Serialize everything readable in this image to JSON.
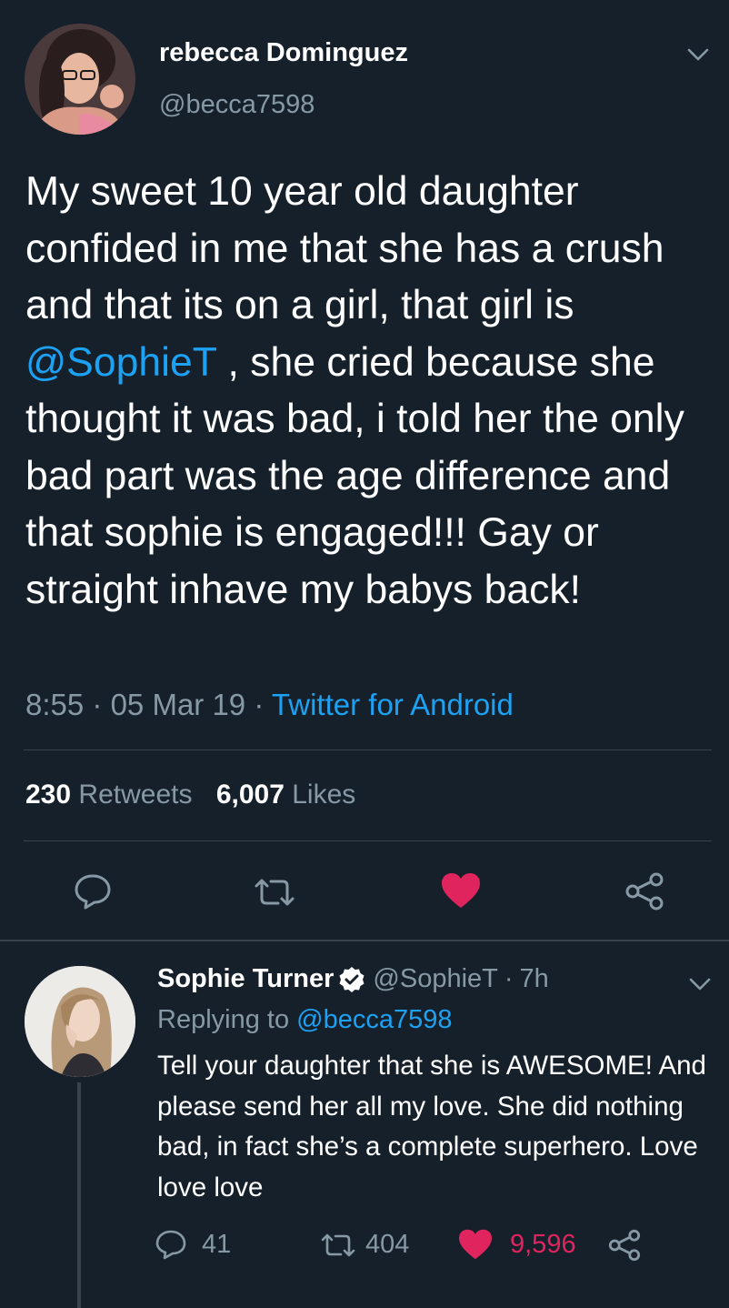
{
  "tweet": {
    "author_name": "rebecca Dominguez",
    "author_handle": "@becca7598",
    "text_parts": {
      "before_mention": "My sweet 10 year old daughter confided in me that she has a crush and that its on a girl,  that girl is ",
      "mention": "@SophieT",
      "after_mention": " , she cried because she thought it was bad, i told her the only bad part was the age difference and that sophie is engaged!!! Gay or straight inhave my babys back!"
    },
    "time": "8:55",
    "date": "05 Mar 19",
    "source": "Twitter for Android",
    "separator": "·",
    "retweets_count": "230",
    "retweets_label": "Retweets",
    "likes_count": "6,007",
    "likes_label": "Likes"
  },
  "reply": {
    "author_name": "Sophie Turner",
    "author_handle": "@SophieT",
    "time_ago": "7h",
    "separator": "·",
    "replying_prefix": "Replying to ",
    "replying_to": "@becca7598",
    "text": "Tell your daughter that she is AWESOME! And please send her all my love. She did nothing bad, in fact she’s a complete superhero. Love love love",
    "reply_count": "41",
    "retweet_count": "404",
    "like_count": "9,596"
  },
  "colors": {
    "background": "#15202b",
    "accent": "#1da1f2",
    "like": "#e0245e",
    "muted": "#8899a6",
    "divider": "#38444d"
  },
  "icons": [
    "chevron-down-icon",
    "reply-icon",
    "retweet-icon",
    "heart-icon",
    "share-icon",
    "verified-badge-icon"
  ]
}
